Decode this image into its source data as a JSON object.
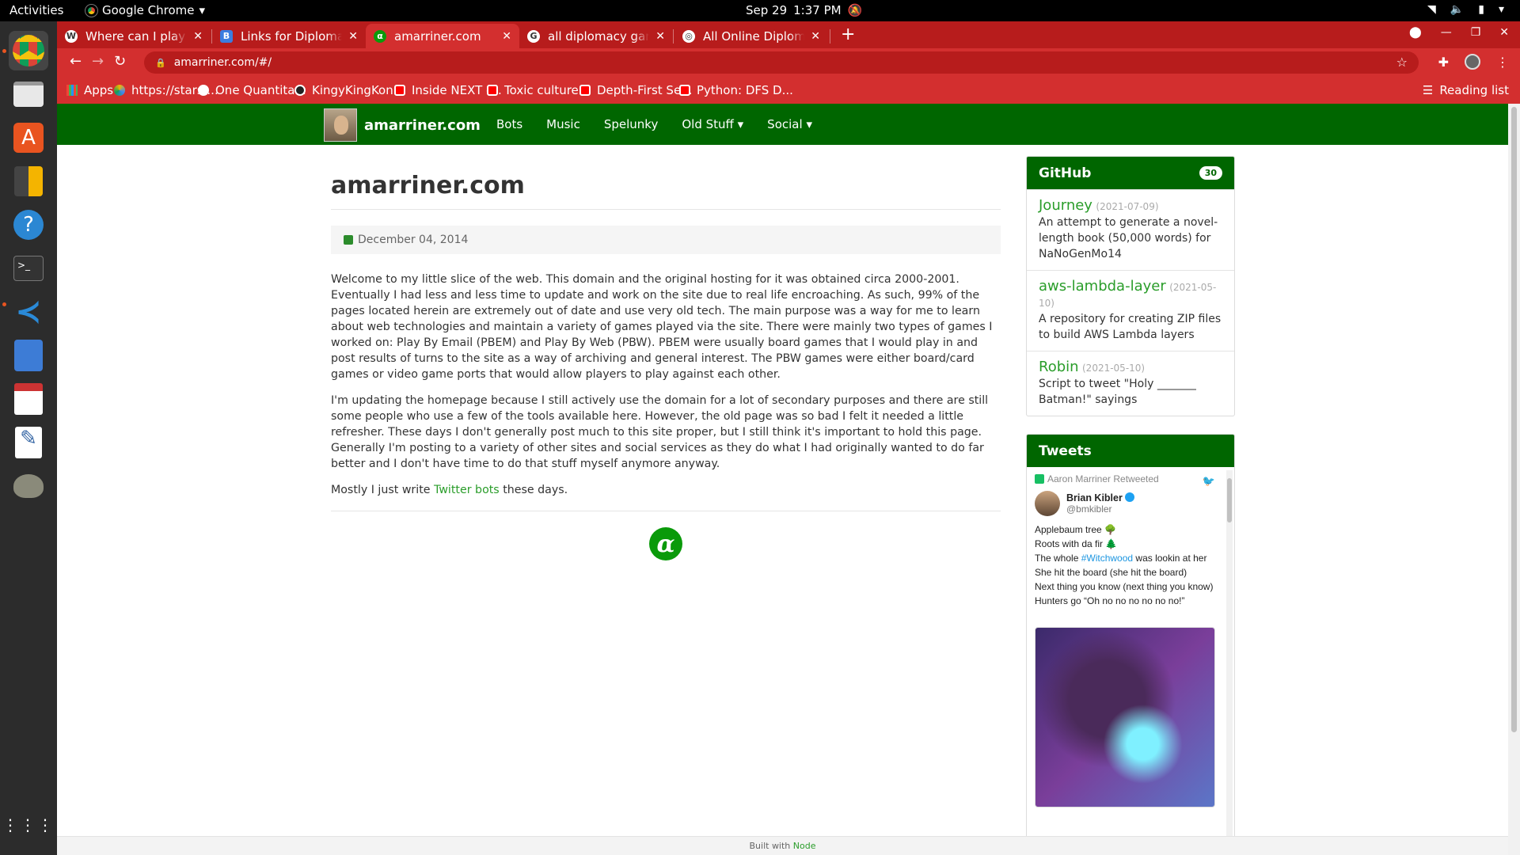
{
  "os": {
    "activities": "Activities",
    "app_name": "Google Chrome",
    "date": "Sep 29",
    "time": "1:37 PM"
  },
  "tabs": [
    {
      "title": "Where can I play Diplomacy"
    },
    {
      "title": "Links for Diplomacy | Ultra"
    },
    {
      "title": "amarriner.com"
    },
    {
      "title": "all diplomacy game sights"
    },
    {
      "title": "All Online Diplomacy Web"
    }
  ],
  "address": {
    "url": "amarriner.com/#/"
  },
  "bookmarks": [
    {
      "label": "Apps"
    },
    {
      "label": "https://stars...."
    },
    {
      "label": "One Quantita..."
    },
    {
      "label": "KingyKingKon..."
    },
    {
      "label": "Inside NEXT -..."
    },
    {
      "label": "Toxic culture..."
    },
    {
      "label": "Depth-First Se..."
    },
    {
      "label": "Python: DFS D..."
    }
  ],
  "reading_list": "Reading list",
  "site": {
    "brand": "amarriner.com",
    "nav": [
      "Bots",
      "Music",
      "Spelunky",
      "Old Stuff",
      "Social"
    ],
    "caret": "▾"
  },
  "post": {
    "title": "amarriner.com",
    "date": "December 04, 2014",
    "p1": "Welcome to my little slice of the web. This domain and the original hosting for it was obtained circa 2000-2001. Eventually I had less and less time to update and work on the site due to real life encroaching. As such, 99% of the pages located herein are extremely out of date and use very old tech. The main purpose was a way for me to learn about web technologies and maintain a variety of games played via the site. There were mainly two types of games I worked on: Play By Email (PBEM) and Play By Web (PBW). PBEM were usually board games that I would play in and post results of turns to the site as a way of archiving and general interest. The PBW games were either board/card games or video game ports that would allow players to play against each other.",
    "p2": "I'm updating the homepage because I still actively use the domain for a lot of secondary purposes and there are still some people who use a few of the tools available here. However, the old page was so bad I felt it needed a little refresher. These days I don't generally post much to this site proper, but I still think it's important to hold this page. Generally I'm posting to a variety of other sites and social services as they do what I had originally wanted to do far better and I don't have time to do that stuff myself anymore anyway.",
    "p3_pre": "Mostly I just write ",
    "p3_link": "Twitter bots",
    "p3_post": " these days.",
    "logo": "α"
  },
  "github": {
    "title": "GitHub",
    "count": "30",
    "repos": [
      {
        "name": "Journey",
        "date": "(2021-07-09)",
        "desc": "An attempt to generate a novel-length book (50,000 words) for NaNoGenMo14"
      },
      {
        "name": "aws-lambda-layer",
        "date": "(2021-05-10)",
        "desc": "A repository for creating ZIP files to build AWS Lambda layers"
      },
      {
        "name": "Robin",
        "date": "(2021-05-10)",
        "desc": "Script to tweet \"Holy _______ Batman!\" sayings"
      }
    ]
  },
  "tweets": {
    "title": "Tweets",
    "retweet_label": "Aaron Marriner Retweeted",
    "author": "Brian Kibler",
    "handle": "@bmkibler",
    "line1": "Applebaum tree 🌳",
    "line2": "Roots with da fir 🌲",
    "line3_pre": "The whole ",
    "line3_tag": "#Witchwood",
    "line3_post": " was lookin at her",
    "line4": "She hit the board (she hit the board)",
    "line5": "Next thing you know (next thing you know)",
    "line6": "Hunters go “Oh no no no no no no!”"
  },
  "footer": {
    "pre": "Built with ",
    "link": "Node"
  }
}
